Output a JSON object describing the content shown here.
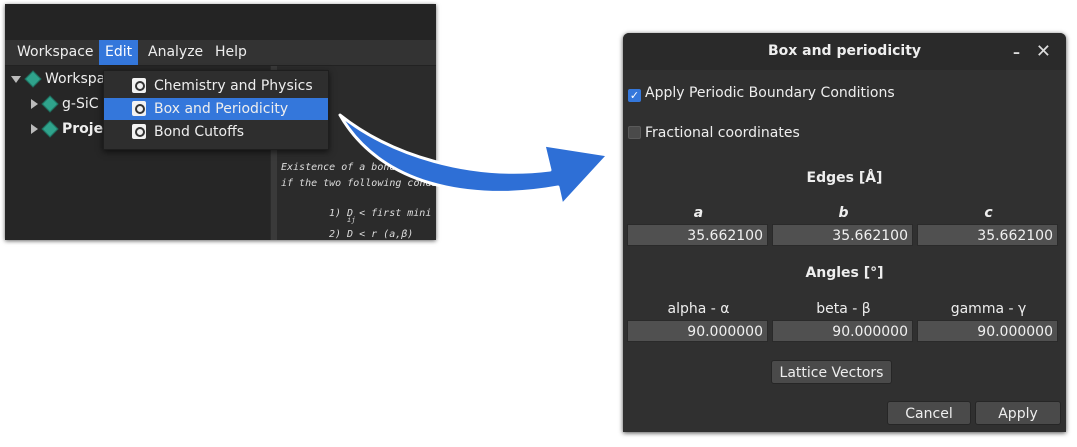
{
  "menubar": {
    "items": [
      "Workspace",
      "Edit",
      "Analyze",
      "Help"
    ]
  },
  "tree": {
    "root_label": "Workspace",
    "child1_label": "g-SiC",
    "child2_label": "Project N"
  },
  "edit_menu": {
    "items": [
      "Chemistry and Physics",
      "Box and Periodicity",
      "Bond Cutoffs"
    ]
  },
  "text_pane": {
    "line1": "Existence of a bond bet",
    "line2": "if the two following condit",
    "line3": "1) D  < first mini",
    "line3_sub": "ij",
    "line4": "2) D  < r  (a,β)",
    "line4_sub": "ij"
  },
  "dialog": {
    "title": "Box and periodicity",
    "minimize_glyph": "–",
    "close_glyph": "✕",
    "apply_pbc_label": "Apply Periodic Boundary Conditions",
    "apply_pbc_checked": true,
    "fractional_label": "Fractional coordinates",
    "fractional_checked": false,
    "edges_title": "Edges [Å]",
    "edges": [
      {
        "label": "a",
        "value": "35.662100"
      },
      {
        "label": "b",
        "value": "35.662100"
      },
      {
        "label": "c",
        "value": "35.662100"
      }
    ],
    "angles_title": "Angles [°]",
    "angles": [
      {
        "label": "alpha - α",
        "value": "90.000000"
      },
      {
        "label": "beta - β",
        "value": "90.000000"
      },
      {
        "label": "gamma - γ",
        "value": "90.000000"
      }
    ],
    "lattice_button": "Lattice Vectors",
    "cancel_button": "Cancel",
    "apply_button": "Apply"
  },
  "colors": {
    "accent": "#3477db",
    "arrow": "#2e6fd6",
    "dialog_bg": "#303030",
    "field_bg": "#505050"
  }
}
